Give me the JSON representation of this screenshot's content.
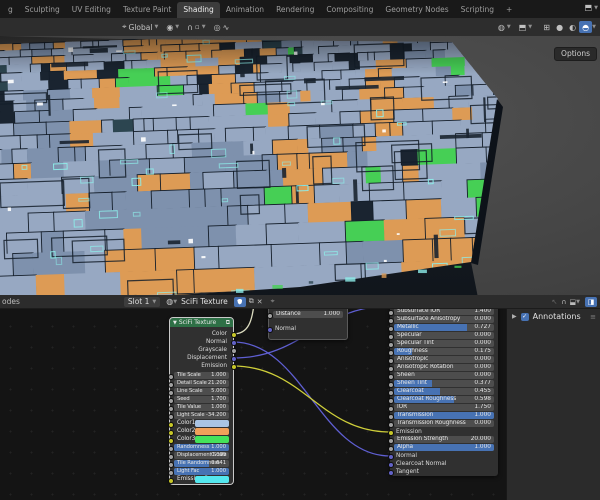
{
  "topbar": {
    "tabs": [
      "g",
      "Sculpting",
      "UV Editing",
      "Texture Paint",
      "Shading",
      "Animation",
      "Rendering",
      "Compositing",
      "Geometry Nodes",
      "Scripting",
      "+"
    ],
    "active_tab": "Shading"
  },
  "viewport": {
    "orientation_label": "Global",
    "options_label": "Options",
    "shading_modes": [
      "wireframe",
      "solid",
      "material-preview",
      "rendered"
    ],
    "active_shading_mode": "rendered",
    "texture": {
      "palette": {
        "base": "#97a8c2",
        "base_dark": "#7e91ad",
        "orange": "#dd9b55",
        "green": "#46cf55",
        "navy": "#1a2430",
        "outline": "#141e2a",
        "glow": "#8deeea",
        "white": "#ffffff",
        "teal_dark": "#2c4550"
      }
    }
  },
  "node_editor": {
    "header": {
      "breadcrumb_fragment": "odes",
      "slot_label": "Slot 1",
      "material_name": "SciFi Texture"
    },
    "sidebar": {
      "panel_label": "Annotations"
    },
    "distance_node": {
      "field_label": "Distance",
      "field_value": "1.000",
      "normal_label": "Normal"
    },
    "scifi_node": {
      "title": "SciFi Texture",
      "outputs": [
        {
          "label": "Color",
          "socket": "#c7c729"
        },
        {
          "label": "Normal",
          "socket": "#6363c7"
        },
        {
          "label": "Grayscale",
          "socket": "#a1a1a1"
        },
        {
          "label": "Displacement",
          "socket": "#6363c7"
        },
        {
          "label": "Emission",
          "socket": "#c7c729"
        }
      ],
      "inputs": [
        {
          "label": "Tile Scale",
          "value": "1.000",
          "fill": 0
        },
        {
          "label": "Detail Scale",
          "value": "21.200",
          "fill": 0
        },
        {
          "label": "Line Scale",
          "value": "5.000",
          "fill": 0
        },
        {
          "label": "Seed",
          "value": "1.700",
          "fill": 0
        },
        {
          "label": "Tile Value",
          "value": "1.000",
          "fill": 0
        },
        {
          "label": "Light Scale",
          "value": "-34.200",
          "fill": 0
        },
        {
          "label": "Color1",
          "color": "#a9c4e4"
        },
        {
          "label": "Color2",
          "color": "#f0a05a"
        },
        {
          "label": "Color3",
          "color": "#44e25b"
        },
        {
          "label": "Randomness",
          "value": "1.000",
          "fill": 1
        },
        {
          "label": "Displacement Scale",
          "value": "0.009",
          "fill": 0
        },
        {
          "label": "Tile Randomness",
          "value": "0.641",
          "fill": 0.64
        },
        {
          "label": "Light Fac",
          "value": "1.000",
          "fill": 1
        },
        {
          "label": "Emission C...",
          "color": "#54e7ee"
        }
      ]
    },
    "bsdf_node": {
      "rows": [
        {
          "label": "Subsurface IOR",
          "value": "1.400",
          "fill": 0
        },
        {
          "label": "Subsurface Anisotropy",
          "value": "0.000",
          "fill": 0
        },
        {
          "label": "Metallic",
          "value": "0.727",
          "fill": 0.73
        },
        {
          "label": "Specular",
          "value": "0.000",
          "fill": 0
        },
        {
          "label": "Specular Tint",
          "value": "0.000",
          "fill": 0
        },
        {
          "label": "Roughness",
          "value": "0.175",
          "fill": 0.18
        },
        {
          "label": "Anisotropic",
          "value": "0.000",
          "fill": 0
        },
        {
          "label": "Anisotropic Rotation",
          "value": "0.000",
          "fill": 0
        },
        {
          "label": "Sheen",
          "value": "0.000",
          "fill": 0
        },
        {
          "label": "Sheen Tint",
          "value": "0.377",
          "fill": 0.38
        },
        {
          "label": "Clearcoat",
          "value": "0.455",
          "fill": 0.46
        },
        {
          "label": "Clearcoat Roughness",
          "value": "0.598",
          "fill": 0.6
        },
        {
          "label": "IOR",
          "value": "1.750",
          "fill": 0
        },
        {
          "label": "Transmission",
          "value": "1.000",
          "fill": 1
        },
        {
          "label": "Transmission Roughness",
          "value": "0.000",
          "fill": 0
        },
        {
          "label": "Emission",
          "socket": "#c7c729",
          "connected": true
        },
        {
          "label": "Emission Strength",
          "value": "20.000",
          "fill": 0
        },
        {
          "label": "Alpha",
          "value": "1.000",
          "fill": 1
        },
        {
          "label": "Normal",
          "socket": "#6363c7",
          "connected": true
        },
        {
          "label": "Clearcoat Normal",
          "socket": "#6363c7",
          "connected": false
        },
        {
          "label": "Tangent",
          "socket": "#6363c7",
          "connected": false
        }
      ]
    },
    "links": [
      {
        "from": "scifi.Color",
        "to": "offscreen.top",
        "color": "#dcdcc0"
      },
      {
        "from": "scifi.Normal",
        "to": "bsdf.Normal",
        "color": "#5f5fd3"
      },
      {
        "from": "scifi.Displacement",
        "to": "offscreen.topright",
        "color": "#5f5fd3"
      },
      {
        "from": "scifi.Emission",
        "to": "bsdf.Emission",
        "color": "#cfcf3a"
      }
    ]
  }
}
